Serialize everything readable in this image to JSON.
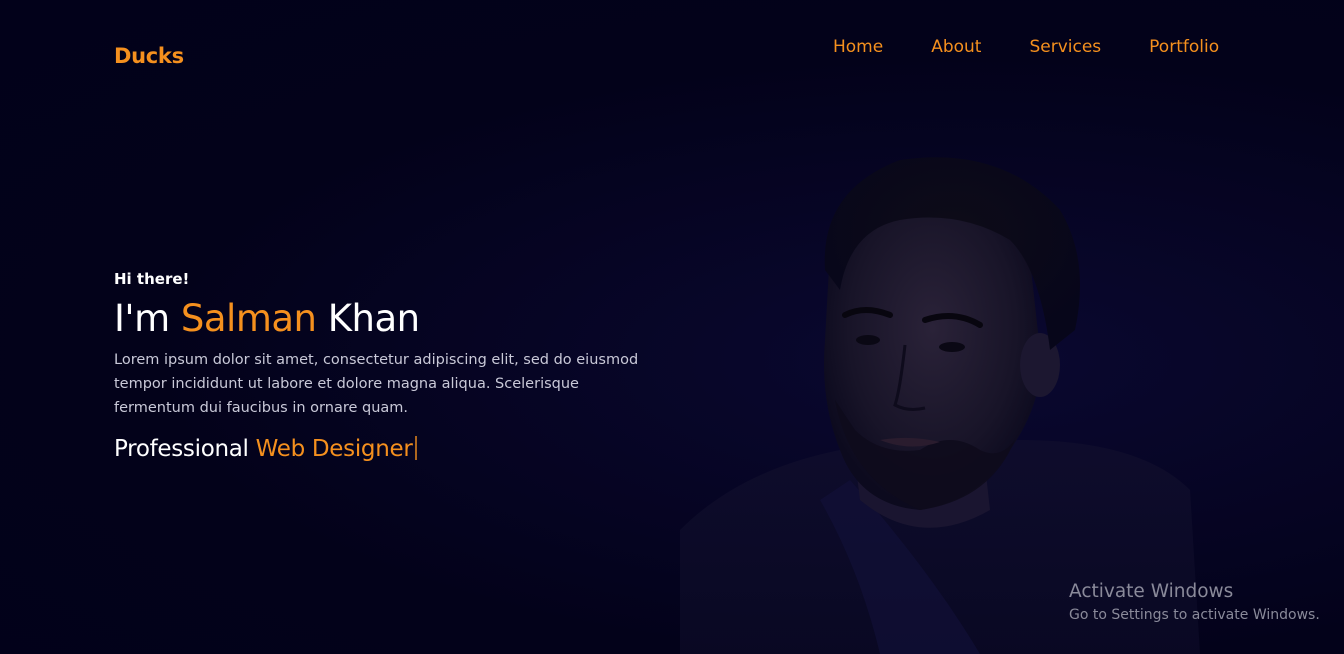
{
  "header": {
    "logo": "Ducks",
    "nav": [
      {
        "label": "Home"
      },
      {
        "label": "About"
      },
      {
        "label": "Services"
      },
      {
        "label": "Portfolio"
      }
    ]
  },
  "hero": {
    "greeting": "Hi there!",
    "name_prefix": "I'm ",
    "name_first": "Salman",
    "name_last": " Khan",
    "description": "Lorem ipsum dolor sit amet, consectetur adipiscing elit, sed do eiusmod tempor incididunt ut labore et dolore magna aliqua. Scelerisque fermentum dui faucibus in ornare quam.",
    "role_prefix": "Professional ",
    "role_accent": "Web Designer"
  },
  "watermark": {
    "title": "Activate Windows",
    "subtitle": "Go to Settings to activate Windows."
  },
  "colors": {
    "accent": "#f5901e",
    "background": "#03021a",
    "text": "#ffffff"
  }
}
